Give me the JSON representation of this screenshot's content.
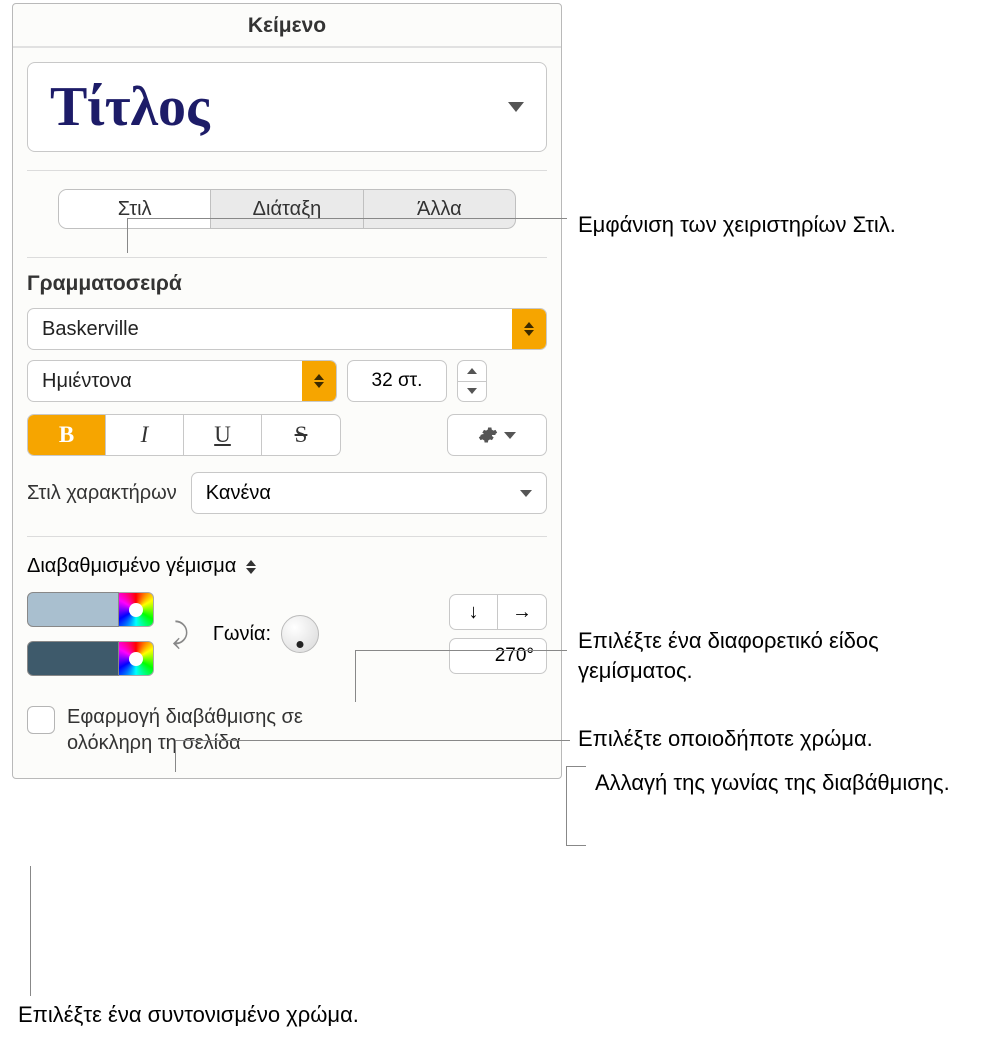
{
  "panel_title": "Κείμενο",
  "style_picker": {
    "label": "Τίτλος"
  },
  "tabs": {
    "style": "Στιλ",
    "layout": "Διάταξη",
    "more": "Άλλα"
  },
  "font_section": "Γραμματοσειρά",
  "font_family": "Baskerville",
  "font_weight": "Ημιέντονα",
  "font_size": "32 στ.",
  "char_style_label": "Στιλ χαρακτήρων",
  "char_style_value": "Κανένα",
  "fill_type": "Διαβαθμισμένο γέμισμα",
  "gradient": {
    "color1": "#a9bfcf",
    "color2": "#3e5a6b",
    "angle_label": "Γωνία:",
    "angle_value": "270°"
  },
  "apply_checkbox": "Εφαρμογή διαβάθμισης σε ολόκληρη τη σελίδα",
  "callouts": {
    "style_tab": "Εμφάνιση των χειριστηρίων Στιλ.",
    "fill_type": "Επιλέξτε ένα διαφορετικό είδος γεμίσματος.",
    "any_color": "Επιλέξτε οποιοδήποτε χρώμα.",
    "angle": "Αλλαγή της γωνίας της διαβάθμισης.",
    "tuned_color": "Επιλέξτε ένα συντονισμένο χρώμα."
  }
}
